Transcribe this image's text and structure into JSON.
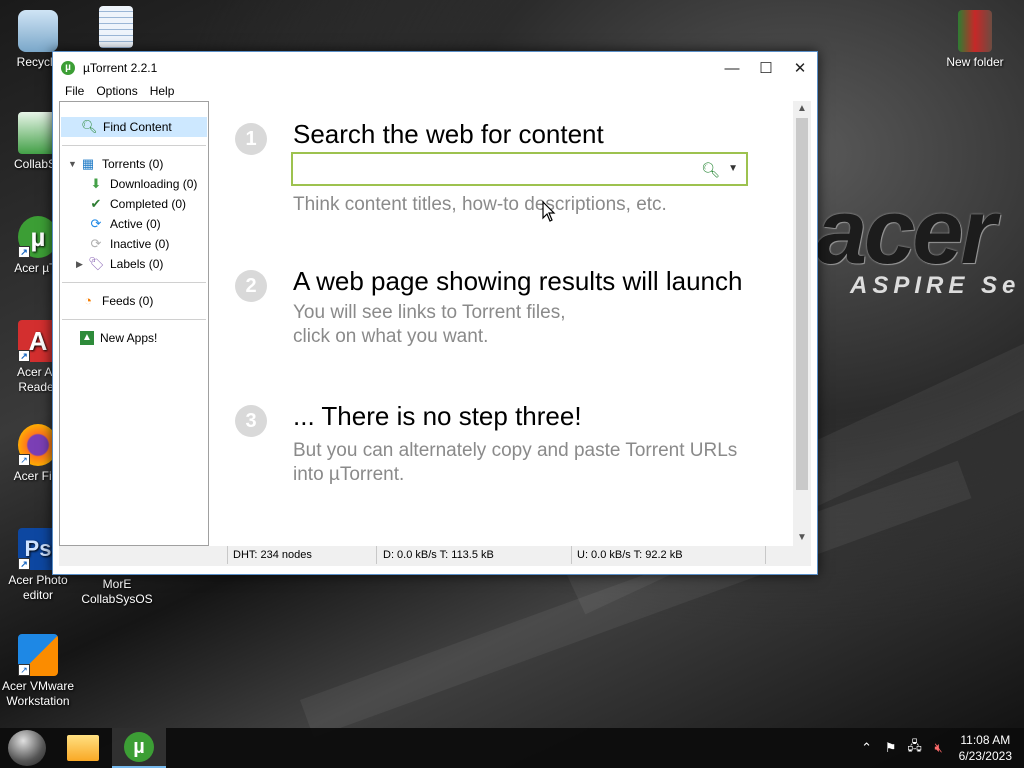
{
  "desktop": {
    "icons": [
      {
        "label": "Recycle"
      },
      {
        "label": ""
      },
      {
        "label": "New folder"
      },
      {
        "label": "CollabSy"
      },
      {
        "label": "Acer µTo"
      },
      {
        "label": "Acer Ad Reader"
      },
      {
        "label": "Acer Fire"
      },
      {
        "label": "Acer Photo editor"
      },
      {
        "label": "MorE CollabSysOS"
      },
      {
        "label": "Acer VMware Workstation"
      }
    ],
    "wallpaper_brand": "acer",
    "wallpaper_subtext": "ASPIRE Se"
  },
  "window": {
    "title": "µTorrent 2.2.1",
    "title_icon": "µ",
    "controls": {
      "minimize": "—",
      "maximize": "☐",
      "close": "✕"
    },
    "menu": [
      "File",
      "Options",
      "Help"
    ],
    "sidebar": {
      "find_content": "Find Content",
      "torrents": "Torrents (0)",
      "downloading": "Downloading (0)",
      "completed": "Completed (0)",
      "active": "Active (0)",
      "inactive": "Inactive (0)",
      "labels": "Labels (0)",
      "feeds": "Feeds (0)",
      "new_apps": "New Apps!"
    },
    "steps": [
      {
        "num": "1",
        "title": "Search the web for content",
        "desc": [
          "Think content titles, how-to descriptions, etc."
        ]
      },
      {
        "num": "2",
        "title": "A web page showing results will launch",
        "desc": [
          "You will see links to Torrent files,",
          "click on what you want."
        ]
      },
      {
        "num": "3",
        "title": "... There is no step three!",
        "desc": [
          "But you can alternately copy and paste Torrent URLs",
          "into µTorrent."
        ]
      }
    ],
    "search": {
      "value": "",
      "placeholder": ""
    },
    "status": {
      "dht": "DHT: 234 nodes",
      "download": "D: 0.0 kB/s T: 113.5 kB",
      "upload": "U: 0.0 kB/s T: 92.2 kB"
    }
  },
  "taskbar": {
    "time": "11:08 AM",
    "date": "6/23/2023"
  },
  "colors": {
    "accent_green": "#3c9e35",
    "search_border": "#9dc24f",
    "selection": "#cde8ff"
  }
}
